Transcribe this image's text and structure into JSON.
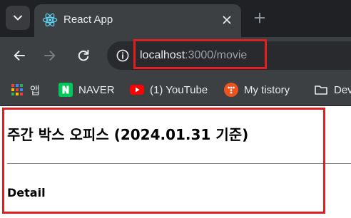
{
  "browser": {
    "tab": {
      "title": "React App",
      "favicon": "react-logo-icon"
    },
    "toolbar": {
      "url_host": "localhost",
      "url_rest": ":3000/movie"
    },
    "bookmarks": [
      {
        "label": "앱",
        "icon": "apps-grid-icon"
      },
      {
        "label": "NAVER",
        "icon": "naver-logo-icon"
      },
      {
        "label": "(1) YouTube",
        "icon": "youtube-logo-icon"
      },
      {
        "label": "My tistory",
        "icon": "tistory-logo-icon"
      },
      {
        "label": "Dev",
        "icon": "folder-icon"
      }
    ]
  },
  "page": {
    "title": "주간 박스 오피스 (2024.01.31 기준)",
    "section_heading": "Detail"
  },
  "colors": {
    "highlight": "#e02020",
    "tab_background": "#3c4043",
    "titlebar_background": "#202124"
  }
}
